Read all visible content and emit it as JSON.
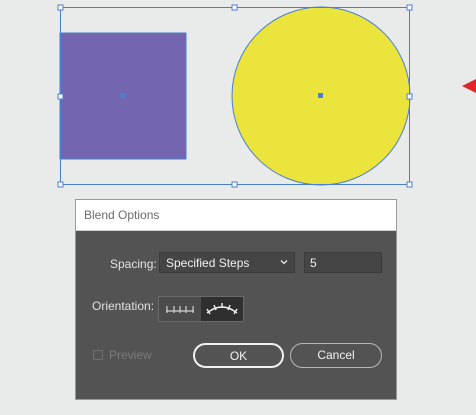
{
  "canvas": {
    "shapes": [
      {
        "kind": "rectangle",
        "fill": "#7465b0",
        "selected": true
      },
      {
        "kind": "circle",
        "fill": "#ebe43c",
        "selected": true
      }
    ],
    "selection_color": "#4a7fd0"
  },
  "dialog": {
    "title": "Blend Options",
    "spacing": {
      "label": "Spacing:",
      "selected": "Specified Steps",
      "steps_value": "5"
    },
    "orientation": {
      "label": "Orientation:",
      "options": [
        {
          "icon": "align-to-page-icon",
          "active": false
        },
        {
          "icon": "align-to-path-icon",
          "active": true
        }
      ]
    },
    "preview": {
      "label": "Preview",
      "checked": false,
      "enabled": false
    },
    "buttons": {
      "ok": "OK",
      "cancel": "Cancel"
    }
  }
}
